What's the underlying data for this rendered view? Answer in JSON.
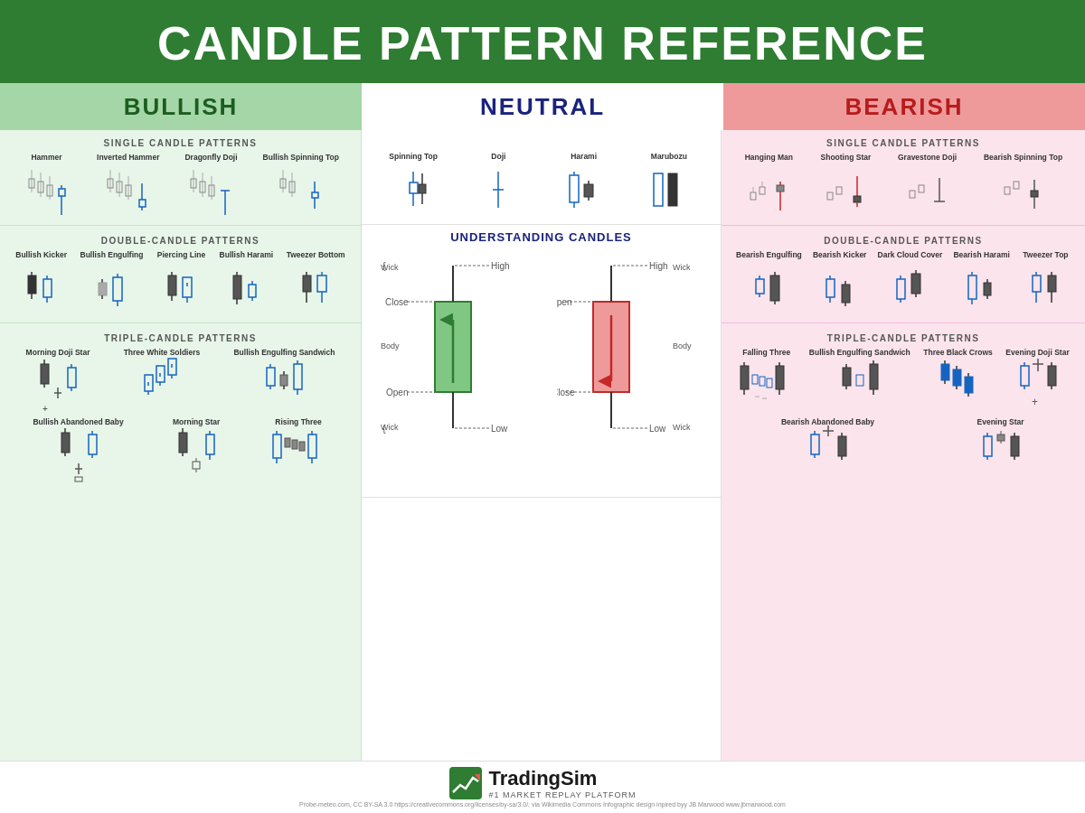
{
  "header": {
    "title": "CANDLE PATTERN REFERENCE"
  },
  "categories": {
    "bullish": "BULLISH",
    "neutral": "NEUTRAL",
    "bearish": "BEARISH"
  },
  "bullish": {
    "single_header": "SINGLE CANDLE PATTERNS",
    "single_patterns": [
      {
        "name": "Hammer"
      },
      {
        "name": "Inverted Hammer"
      },
      {
        "name": "Dragonfly Doji"
      },
      {
        "name": "Bullish Spinning Top"
      }
    ],
    "double_header": "DOUBLE-CANDLE PATTERNS",
    "double_patterns": [
      {
        "name": "Bullish Kicker"
      },
      {
        "name": "Bullish Engulfing"
      },
      {
        "name": "Piercing Line"
      },
      {
        "name": "Bullish Harami"
      },
      {
        "name": "Tweezer Bottom"
      }
    ],
    "triple_header": "TRIPLE-CANDLE PATTERNS",
    "triple_patterns": [
      {
        "name": "Morning Doji Star"
      },
      {
        "name": "Three White Soldiers"
      },
      {
        "name": "Bullish Engulfing Sandwich"
      },
      {
        "name": "Bullish Abandoned Baby"
      },
      {
        "name": "Morning Star"
      },
      {
        "name": "Rising Three"
      }
    ]
  },
  "neutral": {
    "single_patterns": [
      {
        "name": "Spinning Top"
      },
      {
        "name": "Doji"
      },
      {
        "name": "Harami"
      },
      {
        "name": "Marubozu"
      }
    ],
    "understanding_title": "UNDERSTANDING CANDLES",
    "labels": {
      "high": "High",
      "low": "Low",
      "open": "Open",
      "close": "Close",
      "wick_top": "Wick",
      "wick_bottom": "Wick",
      "body": "Body"
    }
  },
  "bearish": {
    "single_header": "SINGLE CANDLE PATTERNS",
    "single_patterns": [
      {
        "name": "Hanging Man"
      },
      {
        "name": "Shooting Star"
      },
      {
        "name": "Gravestone Doji"
      },
      {
        "name": "Bearish Spinning Top"
      }
    ],
    "double_header": "DOUBLE-CANDLE PATTERNS",
    "double_patterns": [
      {
        "name": "Bearish Engulfing"
      },
      {
        "name": "Bearish Kicker"
      },
      {
        "name": "Dark Cloud Cover"
      },
      {
        "name": "Bearish Harami"
      },
      {
        "name": "Tweezer Top"
      }
    ],
    "triple_header": "TRIPLE-CANDLE PATTERNS",
    "triple_patterns": [
      {
        "name": "Falling Three"
      },
      {
        "name": "Bullish Engulfing Sandwich"
      },
      {
        "name": "Three Black Crows"
      },
      {
        "name": "Evening Doji Star"
      },
      {
        "name": "Bearish Abandoned Baby"
      },
      {
        "name": "Evening Star"
      }
    ]
  },
  "footer": {
    "logo_name": "TradingSim",
    "logo_sub": "#1 MARKET REPLAY PLATFORM",
    "credits": "Probe-meteo.com, CC BY-SA 3.0 https://creativecommons.org/licenses/by-sa/3.0/, via Wikimedia Commons     Infographic design inpired byy JB Marwood www.jbmarwood.com"
  }
}
